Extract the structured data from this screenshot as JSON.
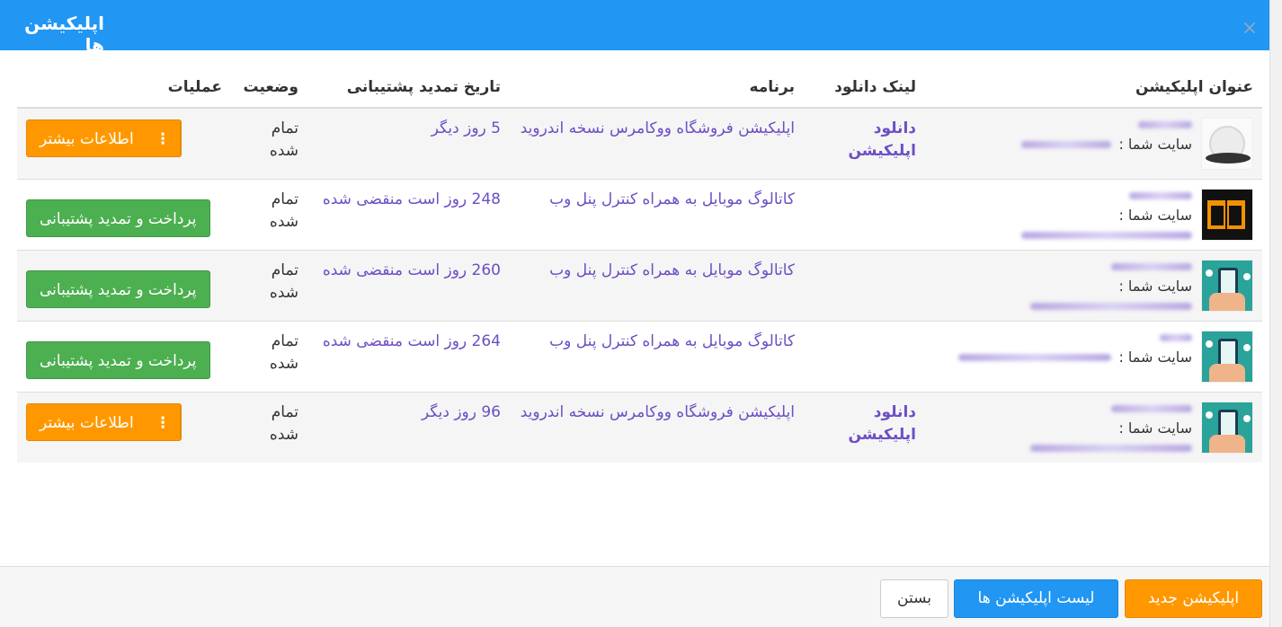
{
  "modal": {
    "title": "اپلیکیشن ها",
    "close_glyph": "×"
  },
  "table": {
    "headers": {
      "title": "عنوان اپلیکیشن",
      "link": "لینک دانلود",
      "program": "برنامه",
      "date": "تاریخ تمدید پشتیبانی",
      "status": "وضعیت",
      "ops": "عملیات"
    },
    "rows": [
      {
        "icon": "robot-vacuum-icon",
        "site_label": "سایت شما :",
        "link_text": "دانلود اپلیکیشن",
        "program": "اپلیکیشن فروشگاه ووکامرس نسخه اندروید",
        "date": "5 روز دیگر",
        "status": "تمام شده",
        "action": "اطلاعات بیشتر",
        "action_type": "more",
        "caret": "⋮"
      },
      {
        "icon": "book-icon",
        "site_label": "سایت شما :",
        "link_text": "",
        "program": "کاتالوگ موبایل به همراه کنترل پنل وب",
        "date": "248 روز است منقضی شده",
        "status": "تمام شده",
        "action": "پرداخت و تمدید پشتیبانی",
        "action_type": "renew"
      },
      {
        "icon": "phone-hand-icon",
        "site_label": "سایت شما :",
        "link_text": "",
        "program": "کاتالوگ موبایل به همراه کنترل پنل وب",
        "date": "260 روز است منقضی شده",
        "status": "تمام شده",
        "action": "پرداخت و تمدید پشتیبانی",
        "action_type": "renew"
      },
      {
        "icon": "phone-hand-icon",
        "site_label": "سایت شما :",
        "link_text": "",
        "program": "کاتالوگ موبایل به همراه کنترل پنل وب",
        "date": "264 روز است منقضی شده",
        "status": "تمام شده",
        "action": "پرداخت و تمدید پشتیبانی",
        "action_type": "renew"
      },
      {
        "icon": "phone-hand-icon",
        "site_label": "سایت شما :",
        "link_text": "دانلود اپلیکیشن",
        "program": "اپلیکیشن فروشگاه ووکامرس نسخه اندروید",
        "date": "96 روز دیگر",
        "status": "تمام شده",
        "action": "اطلاعات بیشتر",
        "action_type": "more",
        "caret": "⋮"
      }
    ]
  },
  "footer": {
    "new_app": "اپلیکیشن جدید",
    "app_list": "لیست اپلیکیشن ها",
    "close": "بستن"
  },
  "colors": {
    "header_blue": "#2196f3",
    "orange": "#ff9800",
    "green": "#4caf50",
    "link_purple": "#6c4fc4"
  }
}
